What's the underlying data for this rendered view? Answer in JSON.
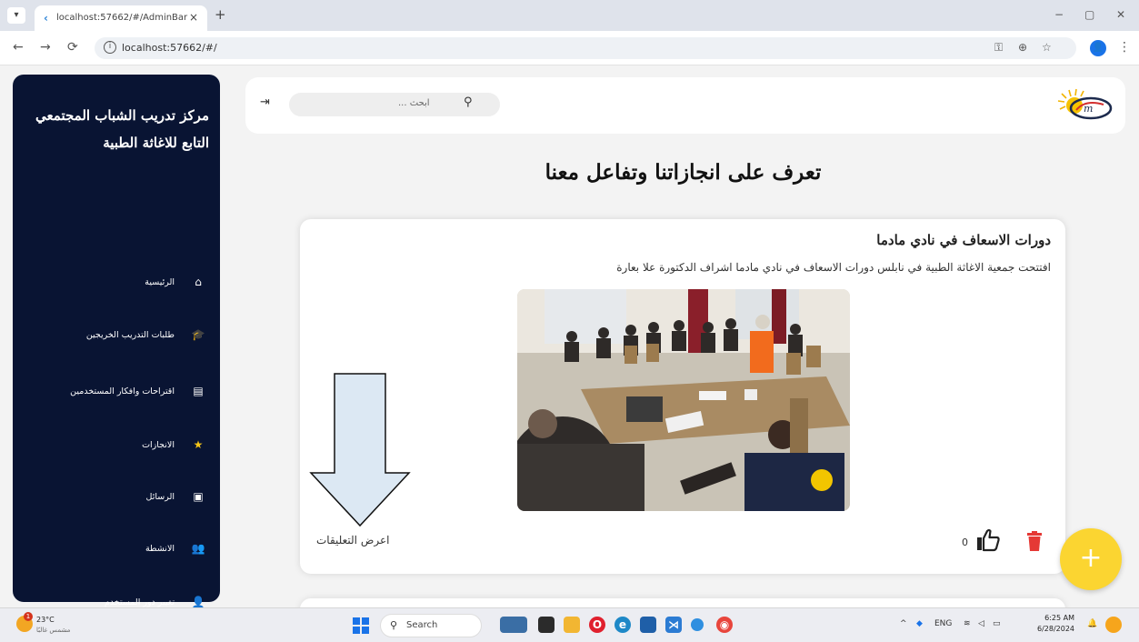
{
  "browser": {
    "tab_title": "localhost:57662/#/AdminBar",
    "tab_close": "×",
    "new_tab": "+",
    "url": "localhost:57662/#/",
    "profile_initial": "👤",
    "window_controls": {
      "minimize": "−",
      "maximize": "▢",
      "close": "✕"
    },
    "icons": {
      "back": "←",
      "forward": "→",
      "reload": "⟳",
      "info": "i",
      "password": "⚿",
      "zoom": "⊕",
      "star": "☆",
      "menu": "⋮",
      "tab_menu": "▾"
    }
  },
  "sidebar": {
    "title": "مركز تدريب الشباب المجتمعي التابع للاغاثة الطبية",
    "items": [
      {
        "label": "الرئيسية",
        "icon": "home-icon",
        "glyph": "⌂"
      },
      {
        "label": "طلبات التدريب الخريجين",
        "icon": "graduation-cap-icon",
        "glyph": "🎓"
      },
      {
        "label": "اقتراحات وافكار المستخدمين",
        "icon": "chat-lines-icon",
        "glyph": "▤"
      },
      {
        "label": "الانجازات",
        "icon": "star-icon",
        "glyph": "★"
      },
      {
        "label": "الرسائل",
        "icon": "contact-card-icon",
        "glyph": "▣"
      },
      {
        "label": "الانشطة",
        "icon": "add-person-icon",
        "glyph": "👥"
      },
      {
        "label": "تغيير دور المستخدم",
        "icon": "add-person-icon",
        "glyph": "👤"
      }
    ]
  },
  "header": {
    "search_placeholder": "ابحث ...",
    "search_icon": "⚲",
    "logout_icon": "⇥"
  },
  "main": {
    "heading": "تعرف على انجازاتنا وتفاعل معنا"
  },
  "post": {
    "title": "دورات الاسعاف في نادي مادما",
    "body": "افتتحت جمعية الاغاثة الطبية في نابلس  دورات الاسعاف في نادي مادما  اشراف الدكتورة علا بعارة",
    "like_count": "0",
    "show_comments": "اعرض التعليقات"
  },
  "fab": {
    "label": "+"
  },
  "taskbar": {
    "weather_temp": "23°C",
    "weather_desc": "مشمس غالبًا",
    "weather_badge": "1",
    "search_label": "Search",
    "search_icon": "⚲",
    "lang": "ENG",
    "time": "6:25 AM",
    "date": "6/28/2024"
  },
  "colors": {
    "sidebar_bg": "#091433",
    "fab": "#fbd531",
    "delete": "#e53935",
    "arrow_fill": "#dce8f3"
  }
}
